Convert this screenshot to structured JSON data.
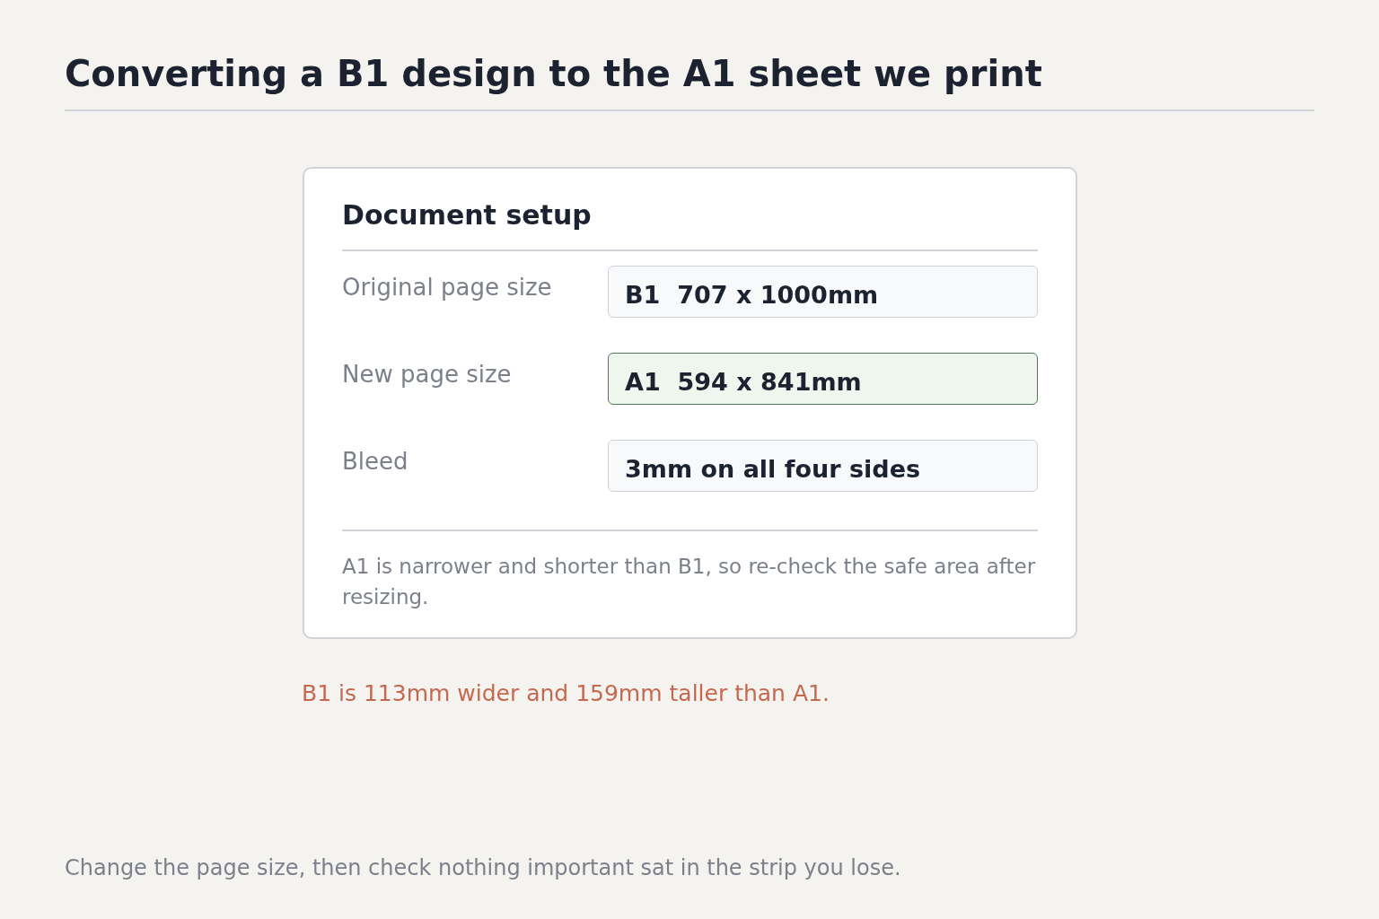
{
  "title": "Converting a B1 design to the A1 sheet we print",
  "card": {
    "heading": "Document setup",
    "fields": [
      {
        "label": "Original page size",
        "value": "B1  707 x 1000mm",
        "highlighted": false
      },
      {
        "label": "New page size",
        "value": "A1  594 x 841mm",
        "highlighted": true
      },
      {
        "label": "Bleed",
        "value": "3mm on all four sides",
        "highlighted": false
      }
    ],
    "note": "A1 is narrower and shorter than B1, so re-check the safe area after resizing."
  },
  "comparison": "B1 is 113mm wider and 159mm taller than A1.",
  "footer": "Change the page size, then check nothing important sat in the strip you lose."
}
